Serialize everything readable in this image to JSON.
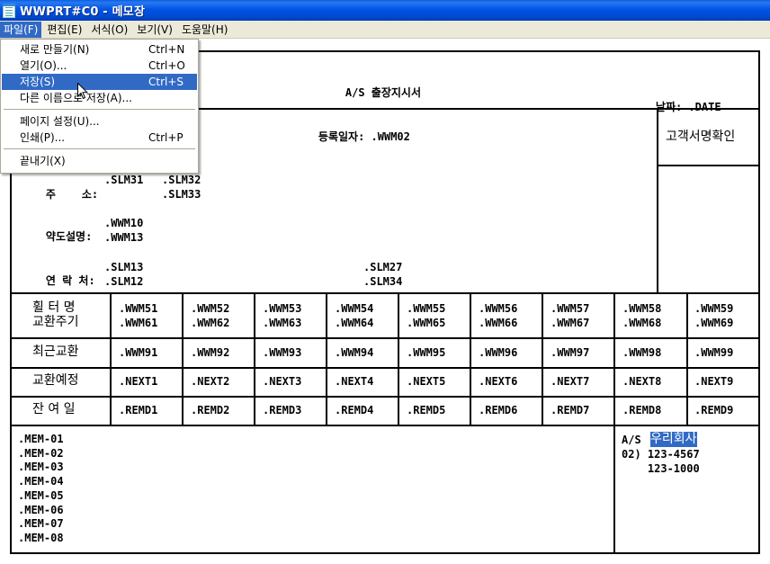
{
  "window": {
    "title": "WWPRT#C0 - 메모장"
  },
  "menubar": [
    "파일(F)",
    "편집(E)",
    "서식(O)",
    "보기(V)",
    "도움말(H)"
  ],
  "file_menu": {
    "items": [
      {
        "label": "새로 만들기(N)",
        "shortcut": "Ctrl+N"
      },
      {
        "label": "열기(O)...",
        "shortcut": "Ctrl+O"
      },
      {
        "label": "저장(S)",
        "shortcut": "Ctrl+S"
      },
      {
        "label": "다른 이름으로 저장(A)...",
        "shortcut": ""
      },
      {
        "label": "페이지 설정(U)...",
        "shortcut": ""
      },
      {
        "label": "인쇄(P)...",
        "shortcut": "Ctrl+P"
      },
      {
        "label": "끝내기(X)",
        "shortcut": ""
      }
    ]
  },
  "form": {
    "title": "A/S 출장지시서",
    "date_label": "날짜: .DATE",
    "reg_date": "등록일자: .WWM02",
    "sign_box": "고객서명확인",
    "address_label": "주    소:",
    "address_1": ".SLM31",
    "address_2": ".SLM32",
    "address_3": ".SLM33",
    "map_label": "약도설명:",
    "map_1": ".WWM10",
    "map_2": ".WWM13",
    "contact_label": "연 락 처:",
    "contact_1": ".SLM13",
    "contact_2": ".SLM12",
    "contact_3": ".SLM27",
    "contact_4": ".SLM34",
    "row_labels": [
      "휠 터 명",
      "교환주기",
      "최근교환",
      "교환예정",
      "잔 여 일"
    ],
    "filter_names": [
      ".WWM51",
      ".WWM52",
      ".WWM53",
      ".WWM54",
      ".WWM55",
      ".WWM56",
      ".WWM57",
      ".WWM58",
      ".WWM59"
    ],
    "filter_cycles": [
      ".WWM61",
      ".WWM62",
      ".WWM63",
      ".WWM64",
      ".WWM65",
      ".WWM66",
      ".WWM67",
      ".WWM68",
      ".WWM69"
    ],
    "recent": [
      ".WWM91",
      ".WWM92",
      ".WWM93",
      ".WWM94",
      ".WWM95",
      ".WWM96",
      ".WWM97",
      ".WWM98",
      ".WWM99"
    ],
    "next": [
      ".NEXT1",
      ".NEXT2",
      ".NEXT3",
      ".NEXT4",
      ".NEXT5",
      ".NEXT6",
      ".NEXT7",
      ".NEXT8",
      ".NEXT9"
    ],
    "remaining": [
      ".REMD1",
      ".REMD2",
      ".REMD3",
      ".REMD4",
      ".REMD5",
      ".REMD6",
      ".REMD7",
      ".REMD8",
      ".REMD9"
    ],
    "memos": [
      ".MEM-01",
      ".MEM-02",
      ".MEM-03",
      ".MEM-04",
      ".MEM-05",
      ".MEM-06",
      ".MEM-07",
      ".MEM-08"
    ],
    "company_prefix": "A/S ",
    "company_name": "우리회사",
    "phone_1": "02) 123-4567",
    "phone_2": "    123-1000"
  }
}
